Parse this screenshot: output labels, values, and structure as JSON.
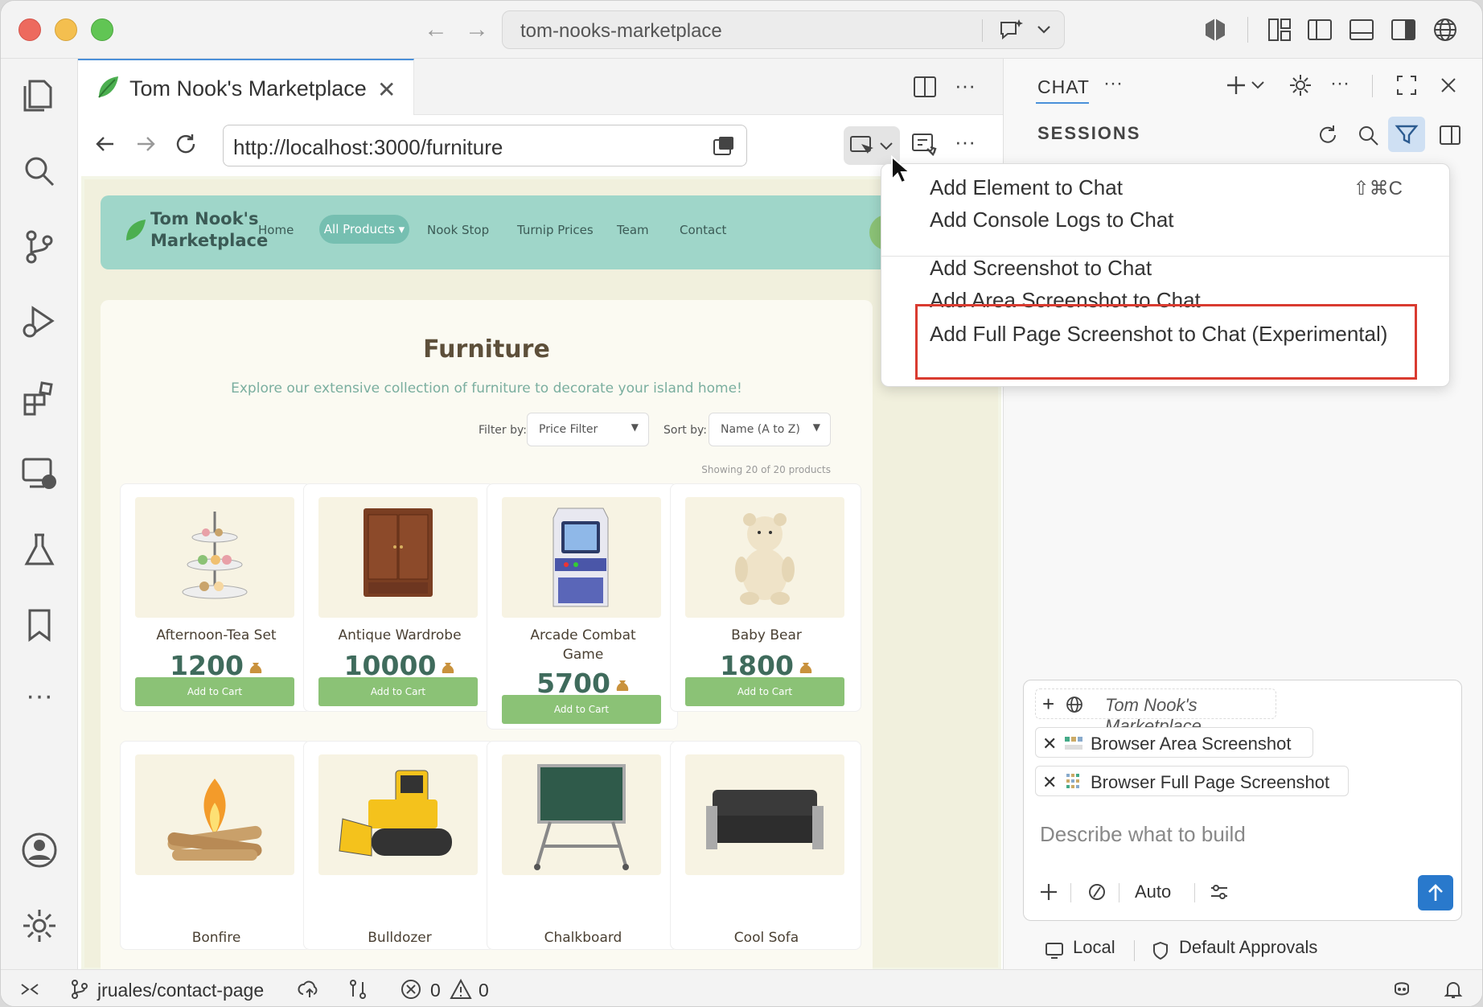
{
  "window": {
    "command_center": "tom-nooks-marketplace"
  },
  "editor": {
    "tab_title": "Tom Nook's Marketplace",
    "url": "http://localhost:3000/furniture"
  },
  "site": {
    "logo": "Tom Nook's Marketplace",
    "logo_line1": "Tom Nook's",
    "logo_line2": "Marketplace",
    "nav": [
      "Home",
      "All Products ▾",
      "Nook Stop",
      "Turnip Prices",
      "Team",
      "Contact"
    ],
    "title": "Furniture",
    "subtitle": "Explore our extensive collection of furniture to decorate your island home!",
    "filter_label": "Filter by:",
    "filter_value": "Price Filter",
    "sort_label": "Sort by:",
    "sort_value": "Name (A to Z)",
    "showing": "Showing 20 of 20 products",
    "add_to_cart": "Add to Cart",
    "products": [
      {
        "name": "Afternoon-Tea Set",
        "price": "1200"
      },
      {
        "name": "Antique Wardrobe",
        "price": "10000"
      },
      {
        "name": "Arcade Combat Game",
        "name_line1": "Arcade Combat",
        "name_line2": "Game",
        "price": "5700"
      },
      {
        "name": "Baby Bear",
        "price": "1800"
      },
      {
        "name": "Bonfire"
      },
      {
        "name": "Bulldozer"
      },
      {
        "name": "Chalkboard"
      },
      {
        "name": "Cool Sofa"
      }
    ],
    "colors": {
      "nav_bg": "#9fd6c9",
      "accent_green": "#8bc276",
      "price_color": "#3f6b5c"
    }
  },
  "chat": {
    "tab": "CHAT",
    "sessions": "SESSIONS",
    "context_chips": [
      "Tom Nook's Marketplace",
      "Browser Area Screenshot",
      "Browser Full Page Screenshot"
    ],
    "placeholder": "Describe what to build",
    "mode": "Auto",
    "footer_local": "Local",
    "footer_approvals": "Default Approvals"
  },
  "menu": {
    "items": [
      {
        "label": "Add Element to Chat",
        "shortcut": "⇧⌘C"
      },
      {
        "label": "Add Console Logs to Chat"
      },
      {
        "label": "Add Screenshot to Chat"
      },
      {
        "label": "Add Area Screenshot to Chat"
      },
      {
        "label": "Add Full Page Screenshot to Chat (Experimental)"
      }
    ],
    "highlight_color": "#d93b30"
  },
  "statusbar": {
    "branch": "jruales/contact-page",
    "errors": "0",
    "warnings": "0"
  }
}
